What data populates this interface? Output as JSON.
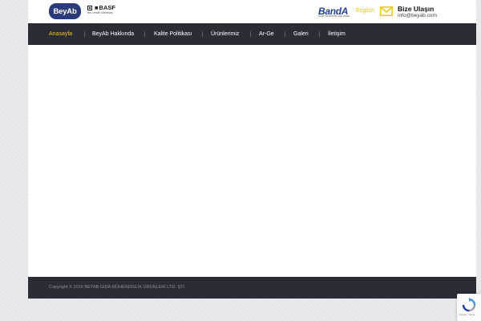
{
  "header": {
    "logo_text": "BeyAb",
    "partner_logo": {
      "brand": "BASF",
      "tagline": "We create chemistry"
    },
    "banda_logo": {
      "brand": "BandA",
      "tagline": "FOOD CONSULTING AND TRADE"
    },
    "language_link": "English",
    "contact": {
      "title": "Bize Ulaşın",
      "email": "info@beyab.com"
    }
  },
  "nav": {
    "items": [
      {
        "label": "Anasayfa",
        "active": true
      },
      {
        "label": "BeyAb Hakkında",
        "active": false
      },
      {
        "label": "Kalite Politikası",
        "active": false
      },
      {
        "label": "Ürünlerimiz",
        "active": false
      },
      {
        "label": "Ar-Ge",
        "active": false
      },
      {
        "label": "Galeri",
        "active": false
      },
      {
        "label": "İletişim",
        "active": false
      }
    ]
  },
  "footer": {
    "copyright": "Copyright © 2016 BEYAB GIDA MÜHENDİSLİK ÜRÜNLERİ LTD. ŞTİ."
  },
  "recaptcha": {
    "label": "Privacy - Terms"
  },
  "colors": {
    "nav_bg": "#2a2c36",
    "active_nav": "#f0c419",
    "brand_blue": "#2b3a78",
    "accent_yellow": "#e8c52a"
  },
  "icons": [
    "mail-icon",
    "recaptcha-icon"
  ]
}
